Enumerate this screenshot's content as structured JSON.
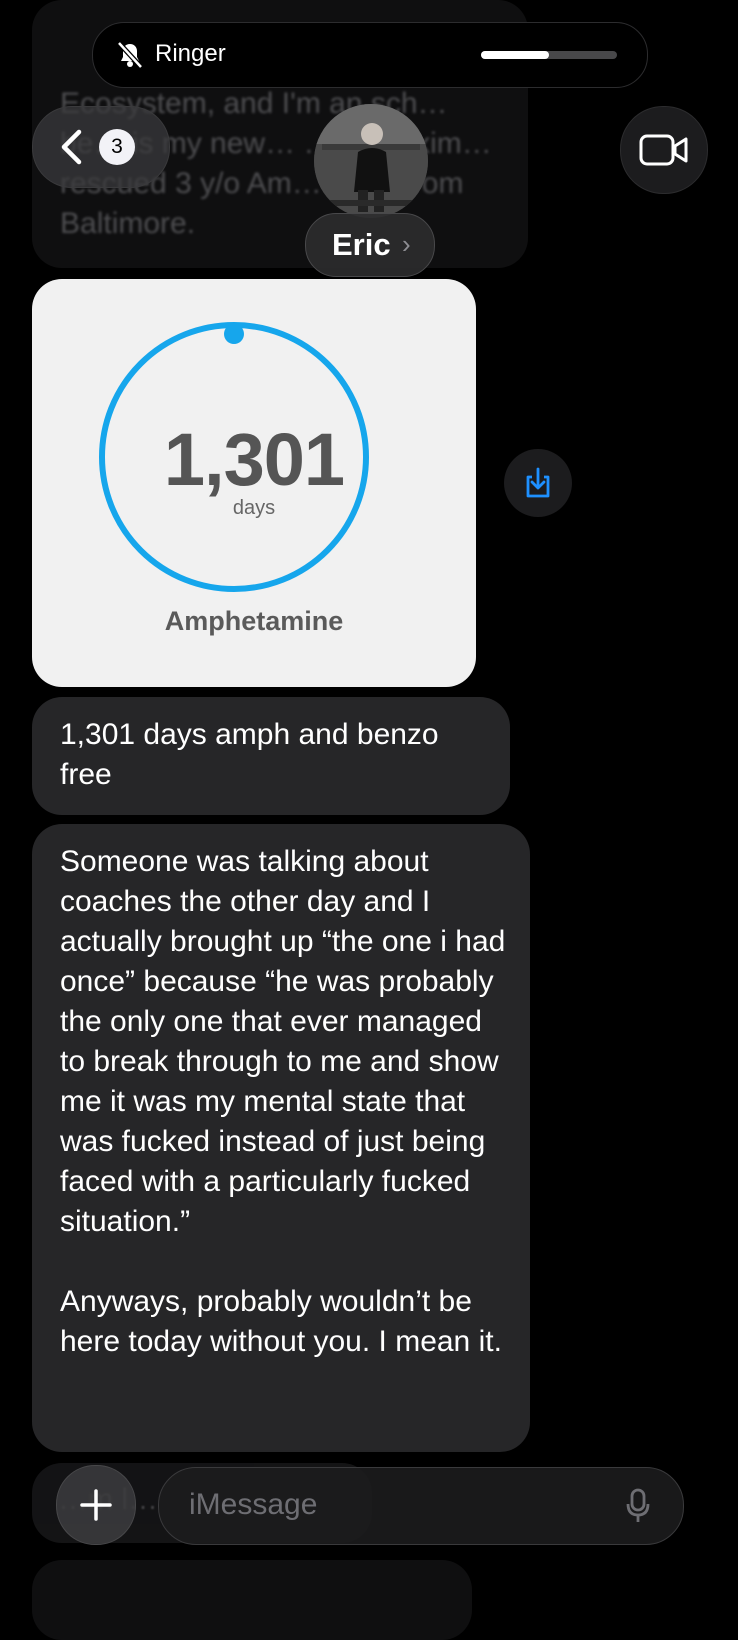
{
  "status": {
    "ringer_label": "Ringer",
    "ringer_volume_fraction": 0.5
  },
  "header": {
    "unread_count": "3",
    "contact_name": "Eric",
    "previous_message_fragment": "Ecosystem, and I'm an sch… be… is my new… …zo Maxim… rescued 3 y/o Am… Bully from Baltimore."
  },
  "card": {
    "count": "1,301",
    "unit": "days",
    "substance": "Amphetamine",
    "ring_color": "#16a6ec"
  },
  "messages": [
    {
      "text": "1,301 days amph and benzo free"
    },
    {
      "paragraphs": [
        "Someone was talking about coaches the other day and I actually brought up “the one i had once” because “he was probably the only one that ever managed to break through to me and show me it was my mental state that was fucked instead of just being faced with a particularly fucked situation.”",
        "Anyways, probably wouldn’t be here today without you. I mean it."
      ]
    }
  ],
  "hidden_message_fragment": "…m l…",
  "composer": {
    "placeholder": "iMessage"
  },
  "icons": {
    "ringer": "bell-slash-icon",
    "back": "chevron-left-icon",
    "video": "video-camera-icon",
    "save": "save-download-icon",
    "add": "plus-icon",
    "mic": "microphone-icon"
  }
}
